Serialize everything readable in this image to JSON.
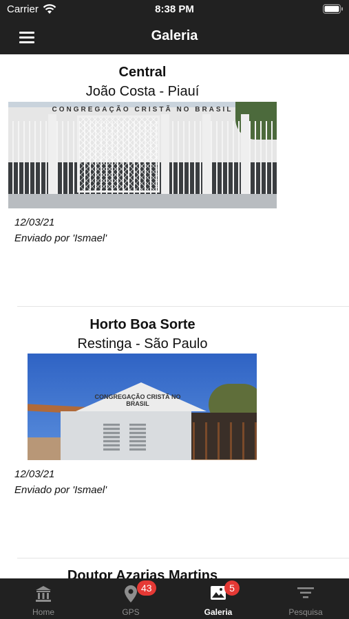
{
  "status_bar": {
    "carrier": "Carrier",
    "time": "8:38 PM"
  },
  "nav": {
    "title": "Galeria"
  },
  "gallery": [
    {
      "title": "Central",
      "location": "João Costa - Piauí",
      "photo_sign": "CONGREGAÇÃO CRISTÃ NO BRASIL",
      "date": "12/03/21",
      "sender": "Enviado por 'Ismael'"
    },
    {
      "title": "Horto Boa Sorte",
      "location": "Restinga - São Paulo",
      "photo_sign": "CONGREGAÇÃO CRISTÃ NO BRASIL",
      "date": "12/03/21",
      "sender": "Enviado por 'Ismael'"
    },
    {
      "title": "Doutor Azarias Martins"
    }
  ],
  "tabs": [
    {
      "label": "Home",
      "icon": "bank-icon"
    },
    {
      "label": "GPS",
      "icon": "location-pin-icon",
      "badge": "43"
    },
    {
      "label": "Galeria",
      "icon": "image-icon",
      "badge": "5",
      "active": true
    },
    {
      "label": "Pesquisa",
      "icon": "filter-icon"
    }
  ],
  "colors": {
    "bar_background": "#212121",
    "badge": "#e53935",
    "inactive_tab": "#8e8e8e"
  }
}
